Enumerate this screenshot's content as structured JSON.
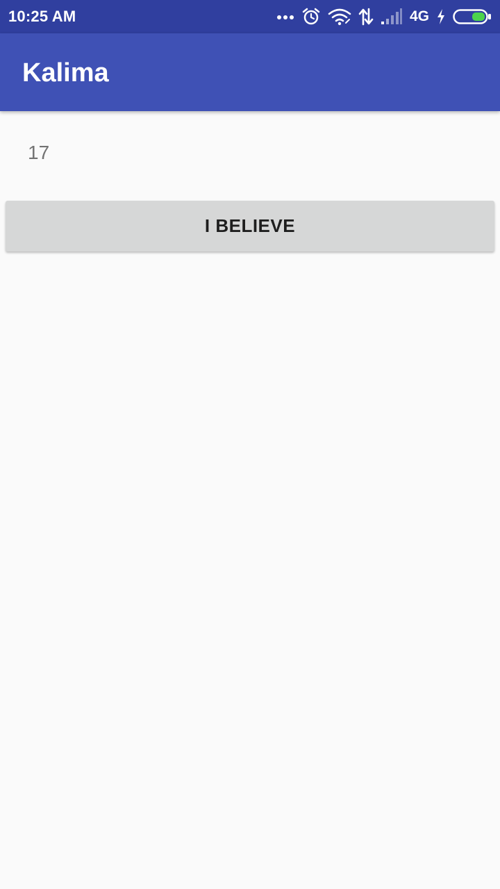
{
  "status_bar": {
    "time": "10:25 AM",
    "network": "4G",
    "icons": [
      "more-dots-icon",
      "alarm-icon",
      "wifi-icon",
      "data-transfer-icon",
      "cell-signal-icon",
      "charging-icon",
      "battery-icon"
    ],
    "battery_color": "#4cd44c"
  },
  "app_bar": {
    "title": "Kalima",
    "color": "#3f51b5"
  },
  "main": {
    "counter": "17",
    "believe_button": "I BELIEVE"
  }
}
